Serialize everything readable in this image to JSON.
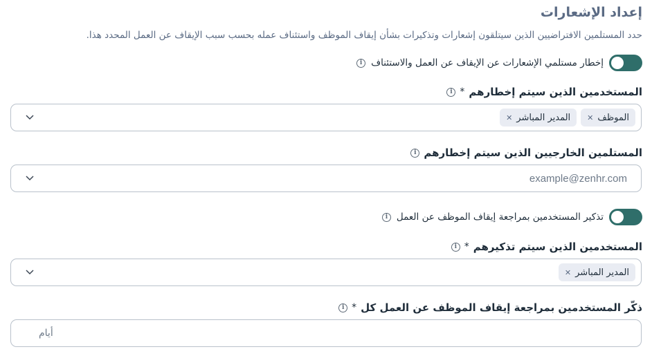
{
  "section": {
    "title": "إعداد الإشعارات",
    "description": "حدد المستلمين الافتراضيين الذين سيتلقون إشعارات وتذكيرات بشأن إيقاف الموظف واستئناف عمله بحسب سبب الإيقاف عن العمل المحدد هذا."
  },
  "notify_toggle": {
    "label": "إخطار مستلمي الإشعارات عن الإيقاف عن العمل والاستئناف",
    "on": true
  },
  "notify_users": {
    "label": "المستخدمين الذين سيتم إخطارهم",
    "required_mark": "*",
    "chips": [
      "الموظف",
      "المدير المباشر"
    ]
  },
  "external_recipients": {
    "label": "المستلمين الخارجيين الذين سيتم إخطارهم",
    "placeholder": "example@zenhr.com"
  },
  "remind_toggle": {
    "label": "تذكير المستخدمين بمراجعة إيقاف الموظف عن العمل",
    "on": true
  },
  "remind_users": {
    "label": "المستخدمين الذين سيتم تذكيرهم",
    "required_mark": "*",
    "chips": [
      "المدير المباشر"
    ]
  },
  "remind_every": {
    "label": "ذكّر المستخدمين بمراجعة إيقاف الموظف عن العمل كل",
    "required_mark": "*",
    "placeholder": "أيام"
  },
  "colors": {
    "toggle_on": "#2f6e6a",
    "title": "#5b6b84",
    "chip_bg": "#e9ecf3",
    "border": "#b9c1cb"
  }
}
